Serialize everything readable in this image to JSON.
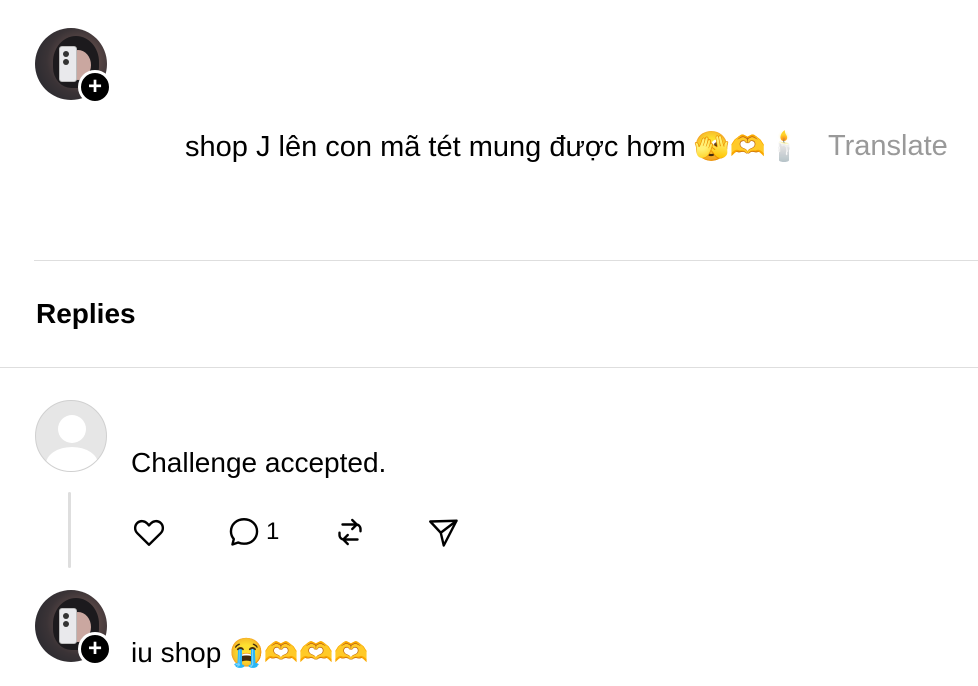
{
  "post": {
    "text": "shop J lên con mã tét mung được hơm 🫣🫶🕯️",
    "translate_label": "Translate"
  },
  "replies_section": {
    "heading": "Replies"
  },
  "replies": [
    {
      "text": "Challenge accepted.",
      "actions": {
        "like_icon": "heart-icon",
        "comment_icon": "comment-icon",
        "comment_count": "1",
        "repost_icon": "repost-icon",
        "share_icon": "send-icon"
      }
    },
    {
      "text": "iu shop 😭🫶🫶🫶"
    }
  ],
  "colors": {
    "text": "#000000",
    "muted": "#999999",
    "divider": "#dedede",
    "badge": "#000000"
  }
}
